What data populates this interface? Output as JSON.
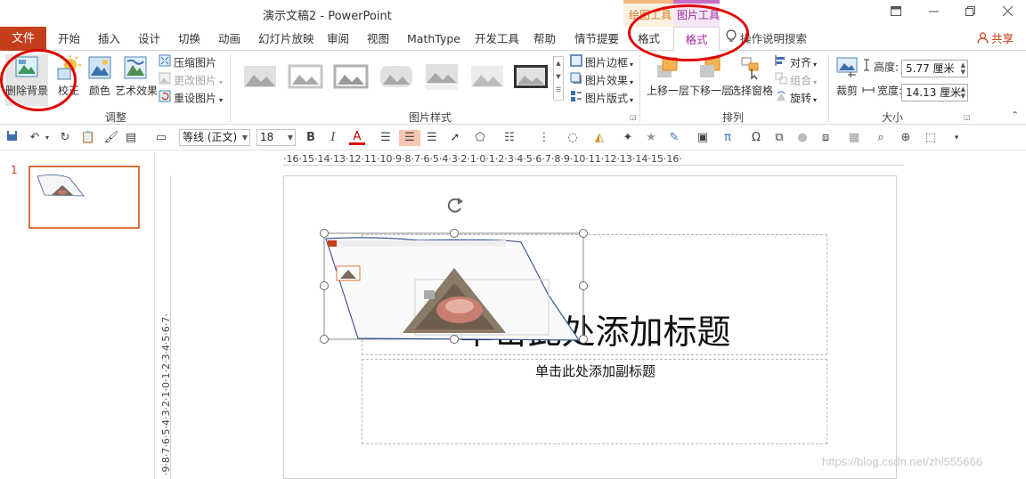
{
  "titlebar": {
    "doc_title": "演示文稿2  -  PowerPoint",
    "context_drawing": "绘图工具",
    "context_picture": "图片工具",
    "window_buttons": [
      "restore-ribbon",
      "minimize",
      "maximize",
      "close"
    ]
  },
  "tabs": {
    "file": "文件",
    "items": [
      "开始",
      "插入",
      "设计",
      "切换",
      "动画",
      "幻灯片放映",
      "审阅",
      "视图",
      "MathType",
      "开发工具",
      "帮助",
      "情节提要",
      "格式",
      "格式"
    ],
    "tell_me": "操作说明搜索",
    "share": "共享"
  },
  "ribbon": {
    "adjust": {
      "label": "调整",
      "remove_bg": "删除背景",
      "corrections": "校正",
      "color": "颜色",
      "artistic": "艺术效果",
      "compress": "压缩图片",
      "change": "更改图片",
      "reset": "重设图片"
    },
    "styles": {
      "label": "图片样式",
      "border": "图片边框",
      "effects": "图片效果",
      "layout": "图片版式"
    },
    "arrange": {
      "label": "排列",
      "bring_forward": "上移一层",
      "send_backward": "下移一层",
      "selection_pane": "选择窗格",
      "align": "对齐",
      "group": "组合",
      "rotate": "旋转"
    },
    "size": {
      "label": "大小",
      "crop": "裁剪",
      "height_label": "高度:",
      "height_value": "5.77 厘米",
      "width_label": "宽度:",
      "width_value": "14.13 厘米"
    }
  },
  "qat": {
    "font_name": "等线 (正文)",
    "font_size": "18",
    "bold": "B",
    "italic": "I",
    "font_color": "A"
  },
  "rulers": {
    "horizontal": "·16·15·14·13·12·11·10·9·8·7·6·5·4·3·2·1·0·1·2·3·4·5·6·7·8·9·10·11·12·13·14·15·16·",
    "vertical": "·9·8·7·6·5·4·3·2·1·0·1·2·3·4·5·6·7·"
  },
  "thumbs": {
    "slide_number": "1"
  },
  "slide": {
    "title": "单击此处添加标题",
    "subtitle": "单击此处添加副标题"
  },
  "watermark": "https://blog.csdn.net/zhl555666",
  "colors": {
    "file_tab": "#c43e1c",
    "context_drawing": "#d87a1f",
    "context_picture": "#a02aa0",
    "annotation": "#e00000"
  }
}
